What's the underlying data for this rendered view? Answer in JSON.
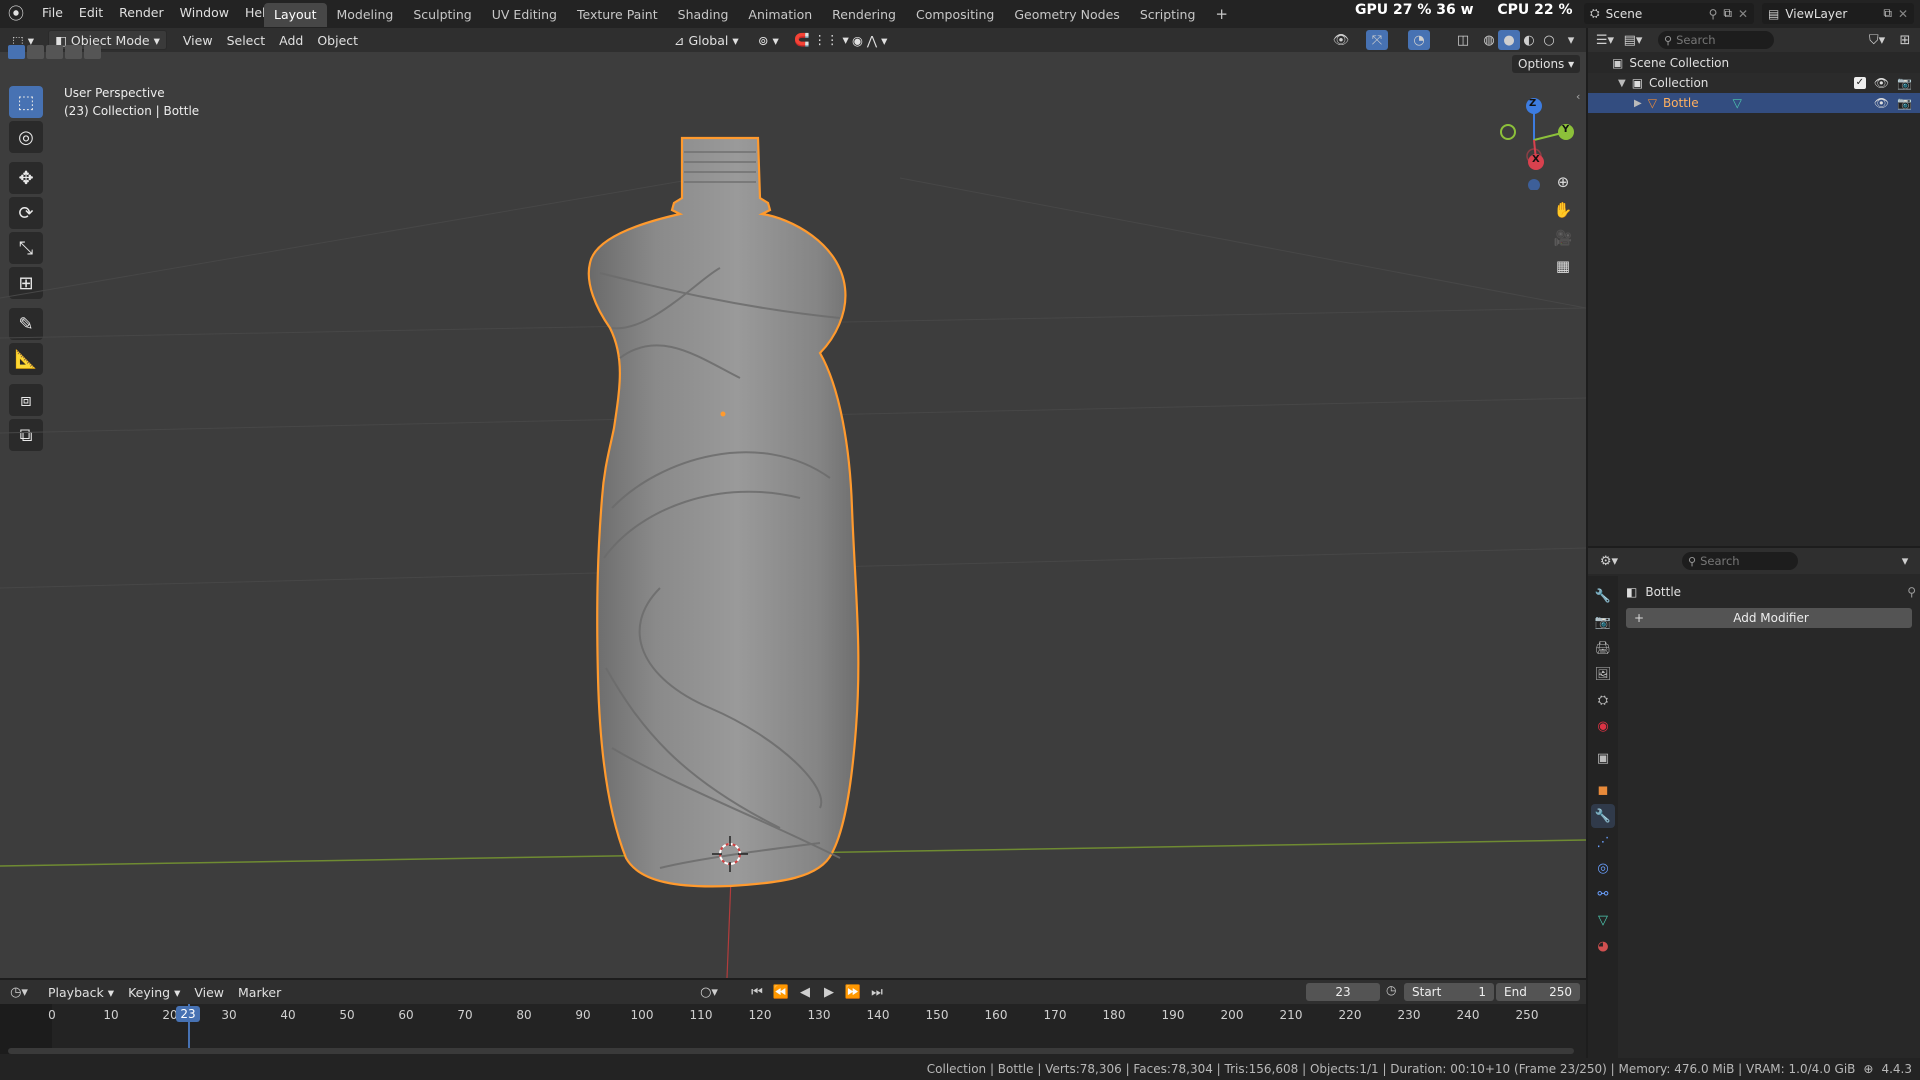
{
  "menu": {
    "items": [
      "File",
      "Edit",
      "Render",
      "Window",
      "Help"
    ]
  },
  "workspaces": [
    "Layout",
    "Modeling",
    "Sculpting",
    "UV Editing",
    "Texture Paint",
    "Shading",
    "Animation",
    "Rendering",
    "Compositing",
    "Geometry Nodes",
    "Scripting"
  ],
  "perf": {
    "gpu_label": "GPU",
    "gpu_value": "27 %",
    "gpu_watts": "36 w",
    "cpu_label": "CPU",
    "cpu_value": "22 %"
  },
  "scene": {
    "name": "Scene",
    "view_layer": "ViewLayer"
  },
  "viewport_header": {
    "mode": "Object Mode",
    "view": "View",
    "select": "Select",
    "add": "Add",
    "object": "Object",
    "orientation": "Global",
    "options": "Options"
  },
  "viewport": {
    "perspective_label": "User Perspective",
    "collection_label": "(23) Collection | Bottle",
    "gizmo": {
      "z": "Z",
      "y": "Y",
      "x": "X"
    }
  },
  "outliner": {
    "search_placeholder": "Search",
    "scene_collection": "Scene Collection",
    "collection": "Collection",
    "object": "Bottle"
  },
  "properties": {
    "search_placeholder": "Search",
    "object_name": "Bottle",
    "add_modifier": "Add Modifier"
  },
  "timeline": {
    "playback": "Playback",
    "keying": "Keying",
    "view": "View",
    "marker": "Marker",
    "current_frame": "23",
    "start_label": "Start",
    "start_value": "1",
    "end_label": "End",
    "end_value": "250",
    "ticks": [
      "0",
      "10",
      "20",
      "30",
      "40",
      "50",
      "60",
      "70",
      "80",
      "90",
      "100",
      "110",
      "120",
      "130",
      "140",
      "150",
      "160",
      "170",
      "180",
      "190",
      "200",
      "210",
      "220",
      "230",
      "240",
      "250"
    ]
  },
  "status_bar": {
    "text": "Collection | Bottle | Verts:78,306 | Faces:78,304 | Tris:156,608 | Objects:1/1 | Duration: 00:10+10 (Frame 23/250) | Memory: 476.0 MiB | VRAM: 1.0/4.0 GiB",
    "version": "4.4.3"
  },
  "colors": {
    "accent": "#4772b3",
    "selection_outline": "#ff9a2e",
    "object_orange": "#e88a3a",
    "axis_x": "#d8414e",
    "axis_y": "#8cc03a",
    "axis_z": "#3d7ce0"
  }
}
